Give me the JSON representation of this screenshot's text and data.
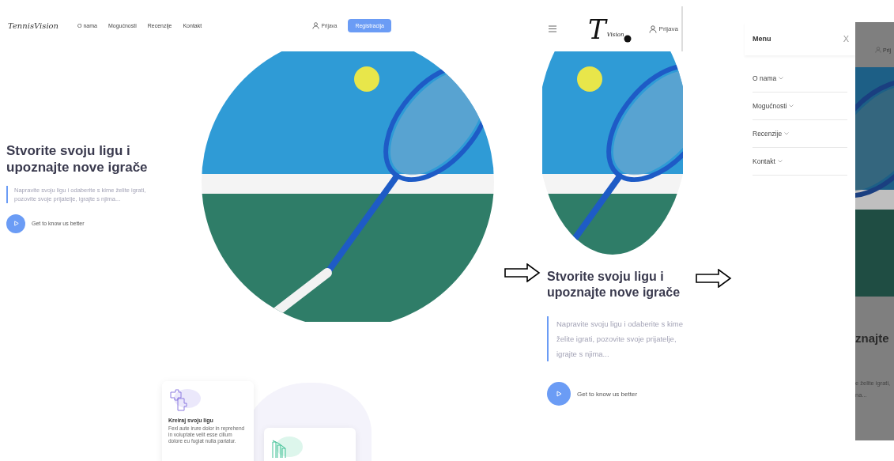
{
  "desktop_page": {
    "logo": "TennisVision",
    "nav": [
      {
        "label": "O nama"
      },
      {
        "label": "Mogućnosti"
      },
      {
        "label": "Recenzije"
      },
      {
        "label": "Kontakt"
      }
    ],
    "login": "Prijava",
    "register": "Registracija",
    "hero": {
      "title": "Stvorite svoju ligu i upoznajte nove igrače",
      "text": "Napravite svoju ligu i odaberite s kime želite igrati, pozovite svoje prijatelje, igrajte s njima...",
      "cta": "Get to know us better"
    },
    "features": [
      {
        "kind": "puzzle",
        "title": "Kreiraj svoju ligu",
        "text": "Fexl aute irure dolor in reprehend in voluptate velit esse cillum dolore eu fugiat nulla pariatur."
      },
      {
        "kind": "chart"
      }
    ]
  },
  "mobile_page": {
    "logo": {
      "letter": "T",
      "word": "Vision"
    },
    "login": "Prijava",
    "hero": {
      "title": "Stvorite svoju ligu i upoznajte nove igrače",
      "text": "Napravite svoju ligu i odaberite s kime želite igrati, pozovite svoje prijatelje, igrajte s njima...",
      "cta": "Get to know us better"
    }
  },
  "menu_screen": {
    "title": "Menu",
    "close": "X",
    "items": [
      {
        "label": "O nama"
      },
      {
        "label": "Mogućnosti"
      },
      {
        "label": "Recenzije"
      },
      {
        "label": "Kontakt"
      }
    ],
    "overlay": {
      "login": "Prij",
      "title": "znajte",
      "lines": [
        "e želite igrati,",
        "na..."
      ]
    }
  }
}
